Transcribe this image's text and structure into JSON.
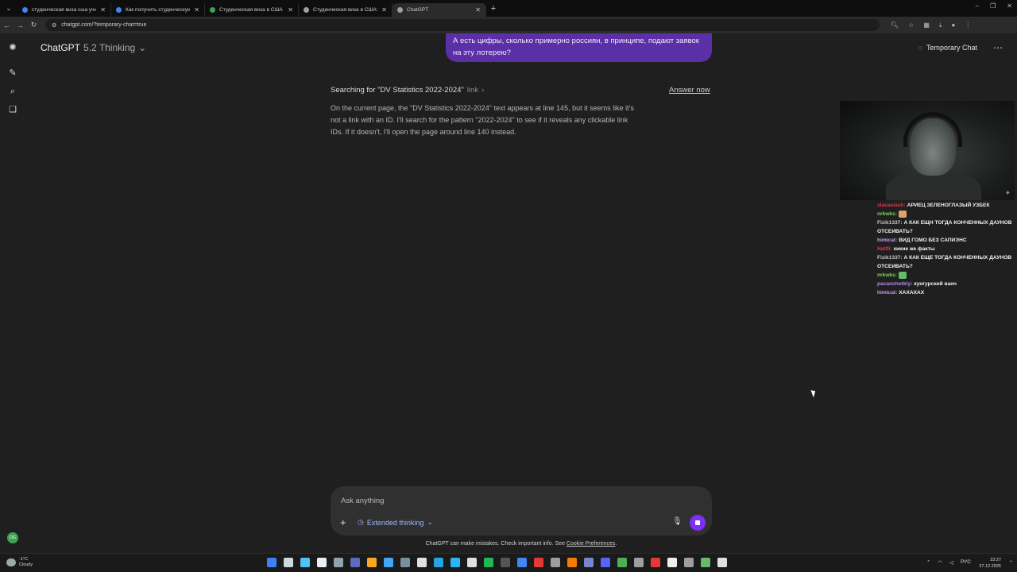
{
  "browser": {
    "tabs": [
      {
        "title": "студенческая виза сша учитсе",
        "color": "#4285f4",
        "active": false
      },
      {
        "title": "Как получить студенческую в",
        "color": "#4285f4",
        "active": false
      },
      {
        "title": "Студенческая виза в США - к",
        "color": "#34a853",
        "active": false
      },
      {
        "title": "Студенческая виза в США: са",
        "color": "#9aa0a6",
        "active": false
      },
      {
        "title": "ChatGPT",
        "color": "#9aa0a6",
        "active": true
      }
    ],
    "url": "chatgpt.com/?temporary-chat=true"
  },
  "header": {
    "model_name": "ChatGPT",
    "model_version": "5.2 Thinking",
    "temporary_chat_label": "Temporary Chat"
  },
  "conversation": {
    "user_message": "А есть цифры, сколько примерно россиян, в принципе, подают заявок на эту лотерею?",
    "search_label": "Searching for \"DV Statistics 2022-2024\"",
    "search_link_label": "link",
    "answer_now_label": "Answer now",
    "thinking_text": "On the current page, the \"DV Statistics 2022-2024\" text appears at line 145, but it seems like it's not a link with an ID. I'll search for the pattern \"2022-2024\" to see if it reveals any clickable link IDs. If it doesn't, I'll open the page around line 140 instead."
  },
  "composer": {
    "placeholder": "Ask anything",
    "mode_label": "Extended thinking",
    "disclaimer_prefix": "ChatGPT can make mistakes. Check important info. See",
    "disclaimer_link": "Cookie Preferences",
    "disclaimer_suffix": "."
  },
  "stream_chat": [
    {
      "nick": "slavaslash:",
      "color": "#e0364c",
      "text": "АРИЕЦ ЗЕЛЕНОГЛАЗЫЙ УЗБЕК"
    },
    {
      "nick": "nrkwks:",
      "color": "#7fd957",
      "text": "",
      "emote": "#e0a070"
    },
    {
      "nick": "Fizik1337:",
      "color": "#c9c9c9",
      "text": "А КАК ЕЩН ТОГДА КОНЧЕННЫХ ДАУНОВ ОТСЕИВАТЬ?"
    },
    {
      "nick": "himicat:",
      "color": "#c89cf2",
      "text": "ВИД ГОМО БЕЗ САПИЭНС"
    },
    {
      "nick": "Hatfli:",
      "color": "#e0364c",
      "text": "кикие же факты"
    },
    {
      "nick": "Fizik1337:",
      "color": "#c9c9c9",
      "text": "А КАК ЕЩЕ ТОГДА КОНЧЕННЫХ ДАУНОВ ОТСЕИВАТЬ?"
    },
    {
      "nick": "nrkwks:",
      "color": "#7fd957",
      "text": "",
      "emote": "#5fbf6a"
    },
    {
      "nick": "pacanchotkiy:",
      "color": "#b48cf0",
      "text": "кунгурский ванч"
    },
    {
      "nick": "himicat:",
      "color": "#c89cf2",
      "text": "ХАХАХАХ"
    }
  ],
  "taskbar": {
    "weather_temp": "-1°C",
    "weather_desc": "Cloudy",
    "language": "РУС",
    "time": "23:27",
    "date": "27.12.2025"
  },
  "colors": {
    "accent": "#7b2ff7",
    "user_bubble": "#5b2fa6"
  }
}
